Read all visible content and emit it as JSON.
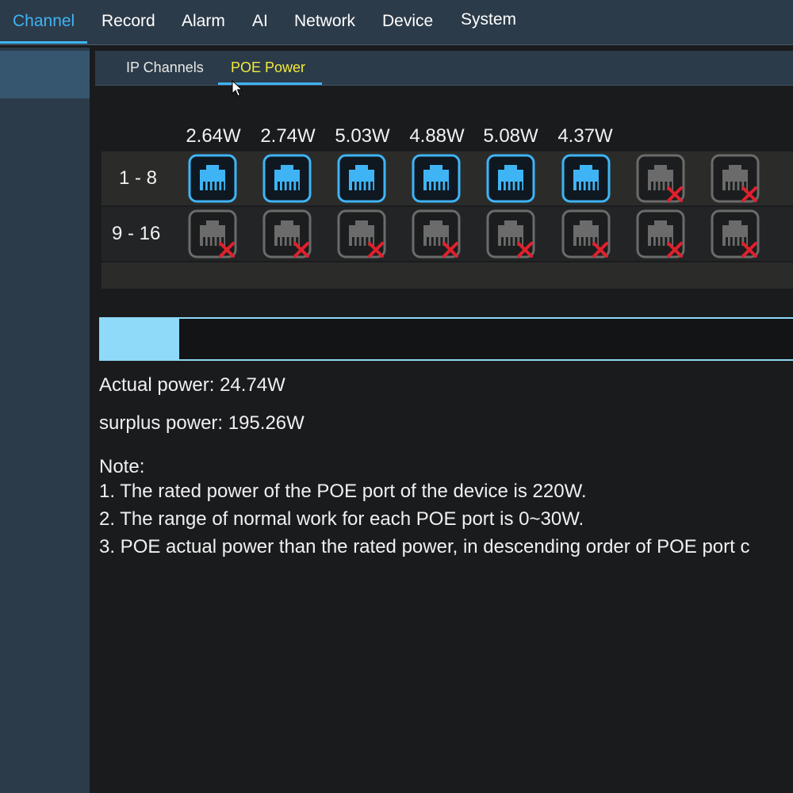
{
  "topnav": {
    "items": [
      {
        "label": "Channel",
        "active": true
      },
      {
        "label": "Record",
        "active": false
      },
      {
        "label": "Alarm",
        "active": false
      },
      {
        "label": "AI",
        "active": false
      },
      {
        "label": "Network",
        "active": false
      },
      {
        "label": "Device",
        "active": false
      },
      {
        "label": "System",
        "active": false
      }
    ]
  },
  "subtabs": {
    "items": [
      {
        "label": "IP Channels",
        "active": false
      },
      {
        "label": "POE Power",
        "active": true
      }
    ]
  },
  "poe": {
    "port_watts": [
      "2.64W",
      "2.74W",
      "5.03W",
      "4.88W",
      "5.08W",
      "4.37W"
    ],
    "rows": [
      {
        "label": "1 - 8",
        "ports": [
          "on",
          "on",
          "on",
          "on",
          "on",
          "on",
          "off",
          "off"
        ]
      },
      {
        "label": "9 - 16",
        "ports": [
          "off",
          "off",
          "off",
          "off",
          "off",
          "off",
          "off",
          "off"
        ]
      }
    ],
    "power_used_fraction": 0.1125,
    "actual_power": "Actual power: 24.74W",
    "surplus_power": "surplus power: 195.26W",
    "note_title": "Note:",
    "notes": [
      "1. The rated power of the POE port of the device is 220W.",
      "2. The range of normal work for each POE port is 0~30W.",
      "3. POE actual power than the rated power, in descending order of POE port c"
    ]
  },
  "colors": {
    "accent": "#3fb4f5",
    "active_tab": "#f2ea3c",
    "port_on": "#3fb4f5",
    "port_off": "#6b6b6b",
    "port_off_mark": "#e0202c",
    "power_fill": "#8fdaf9"
  },
  "icons": {
    "port_on": "ethernet-port-connected-icon",
    "port_off": "ethernet-port-disconnected-icon",
    "cursor": "mouse-cursor-icon"
  }
}
